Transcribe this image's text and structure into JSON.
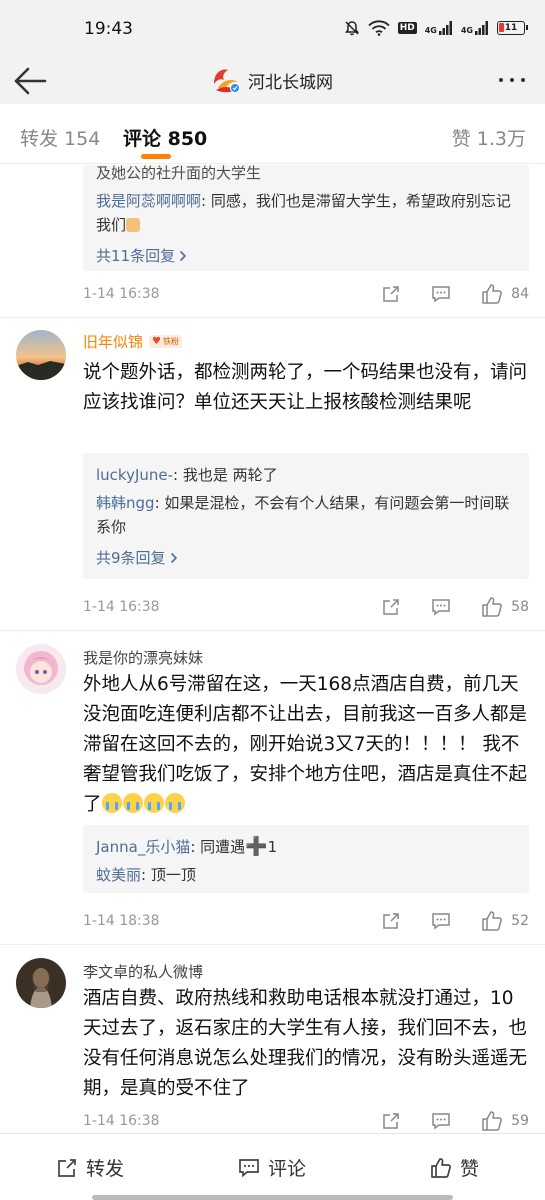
{
  "status_bar": {
    "time": "19:43",
    "hd": "HD",
    "sim1": "4G",
    "sim2": "4G",
    "battery": "11"
  },
  "nav": {
    "title": "河北长城网"
  },
  "tabs": {
    "repost": "转发 154",
    "comment": "评论 850",
    "like": "赞 1.3万"
  },
  "colors": {
    "accent": "#ff8200",
    "link": "#4e6e96"
  },
  "comments": [
    {
      "truncated_reply_top": "及她公的社升面的大学生",
      "replies": [
        {
          "user": "我是阿蕊啊啊啊",
          "text": ": 同感，我们也是滞留大学生，希望政府别忘记我们"
        }
      ],
      "more": "共11条回复",
      "time": "1-14 16:38",
      "likes": "84"
    },
    {
      "user": "旧年似锦",
      "badge": "铁粉",
      "text": "说个题外话，都检测两轮了，一个码结果也没有，请问应该找谁问？单位还天天让上报核酸检测结果呢",
      "replies": [
        {
          "user": "luckyJune-",
          "text": ": 我也是 两轮了"
        },
        {
          "user": "韩韩ngg",
          "text": ": 如果是混检，不会有个人结果，有问题会第一时间联系你"
        }
      ],
      "more": "共9条回复",
      "time": "1-14 16:38",
      "likes": "58"
    },
    {
      "user": "我是你的漂亮妹妹",
      "text": "外地人从6号滞留在这，一天168点酒店自费，前几天没泡面吃连便利店都不让出去，目前我这一百多人都是滞留在这回不去的，刚开始说3又7天的！！！！ 我不奢望管我们吃饭了，安排个地方住吧，酒店是真住不起了",
      "replies": [
        {
          "user": "Janna_乐小猫",
          "text": ": 同遭遇"
        },
        {
          "user": "蚊美丽",
          "text": ": 顶一顶"
        }
      ],
      "reply_suffix": "1",
      "time": "1-14 18:38",
      "likes": "52"
    },
    {
      "user": "李文卓的私人微博",
      "text": "酒店自费、政府热线和救助电话根本就没打通过，10天过去了，返石家庄的大学生有人接，我们回不去，也没有任何消息说怎么处理我们的情况，没有盼头遥遥无期，是真的受不住了",
      "time": "1-14 16:38",
      "likes": "59"
    }
  ],
  "bottom_bar": {
    "repost": "转发",
    "comment": "评论",
    "like": "赞"
  }
}
